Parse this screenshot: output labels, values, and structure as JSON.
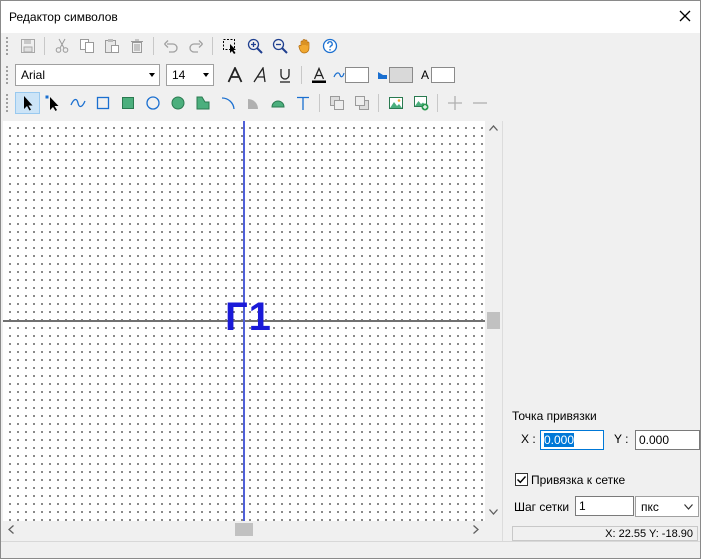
{
  "window": {
    "title": "Редактор символов"
  },
  "toolbar_1": {
    "buttons": [
      "save-icon",
      "cut-icon",
      "copy-icon",
      "paste-icon",
      "delete-icon",
      "undo-icon",
      "redo-icon",
      "select-region-icon",
      "zoom-in-icon",
      "zoom-out-icon",
      "pan-hand-icon",
      "help-icon"
    ]
  },
  "toolbar_2": {
    "font_family": "Arial",
    "font_size": "14",
    "text_style_icons": [
      "font-size-icon",
      "italic-icon",
      "underline-icon"
    ],
    "text_color_label": "A",
    "fill_text_label": "A"
  },
  "toolbar_3": {
    "tools": [
      "pointer-icon",
      "node-select-icon",
      "curve-icon",
      "rectangle-icon",
      "filled-rectangle-icon",
      "ellipse-icon",
      "filled-ellipse-icon",
      "polygon-icon",
      "arc-icon",
      "sector-icon",
      "segment-icon",
      "text-tool-icon",
      "bring-front-icon",
      "send-back-icon",
      "image-icon",
      "add-image-icon",
      "add-point-icon",
      "remove-point-icon"
    ]
  },
  "canvas": {
    "symbol_text": "Г1",
    "colors": {
      "symbol": "#1a1ad8",
      "v_axis": "#5060d8",
      "h_axis": "#707070"
    }
  },
  "anchor_panel": {
    "heading": "Точка привязки",
    "x_label": "X :",
    "x_value": "0.000",
    "y_label": "Y :",
    "y_value": "0.000"
  },
  "grid": {
    "snap_label": "Привязка к сетке",
    "snap_checked": true,
    "step_label": "Шаг сетки",
    "step_value": "1",
    "unit": "пкс"
  },
  "status": {
    "coords": "X: 22.55  Y: -18.90"
  }
}
